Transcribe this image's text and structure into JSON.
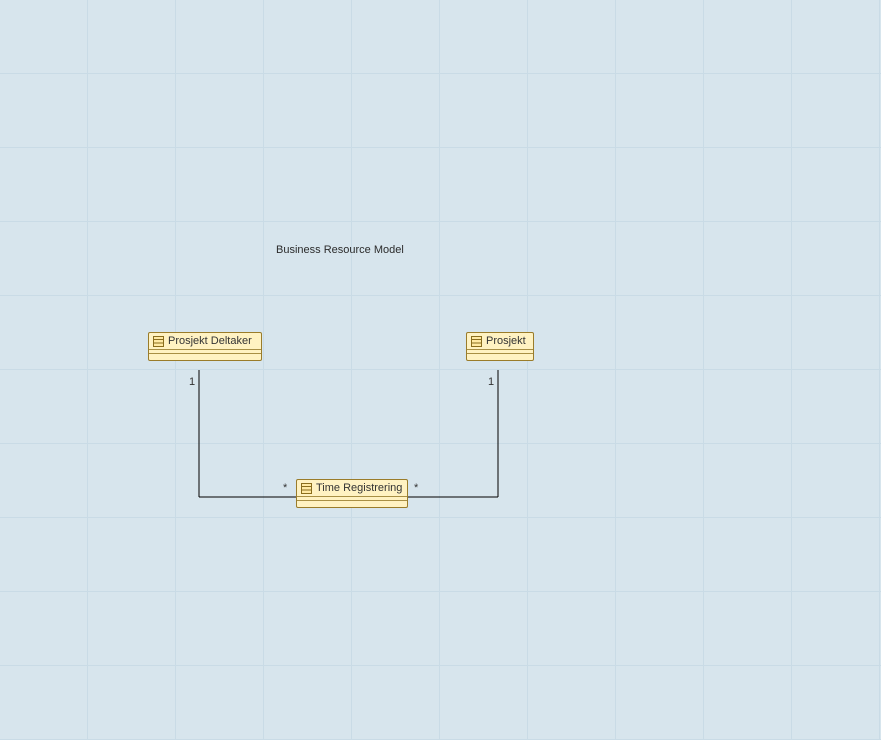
{
  "diagram": {
    "title": "Business Resource Model",
    "classes": {
      "prosjekt_deltaker": {
        "name": "Prosjekt Deltaker"
      },
      "prosjekt": {
        "name": "Prosjekt"
      },
      "time_registrering": {
        "name": "Time Registrering"
      }
    },
    "associations": {
      "deltaker_time": {
        "end_a_mult": "1",
        "end_b_mult": "*"
      },
      "prosjekt_time": {
        "end_a_mult": "1",
        "end_b_mult": "*"
      }
    }
  }
}
